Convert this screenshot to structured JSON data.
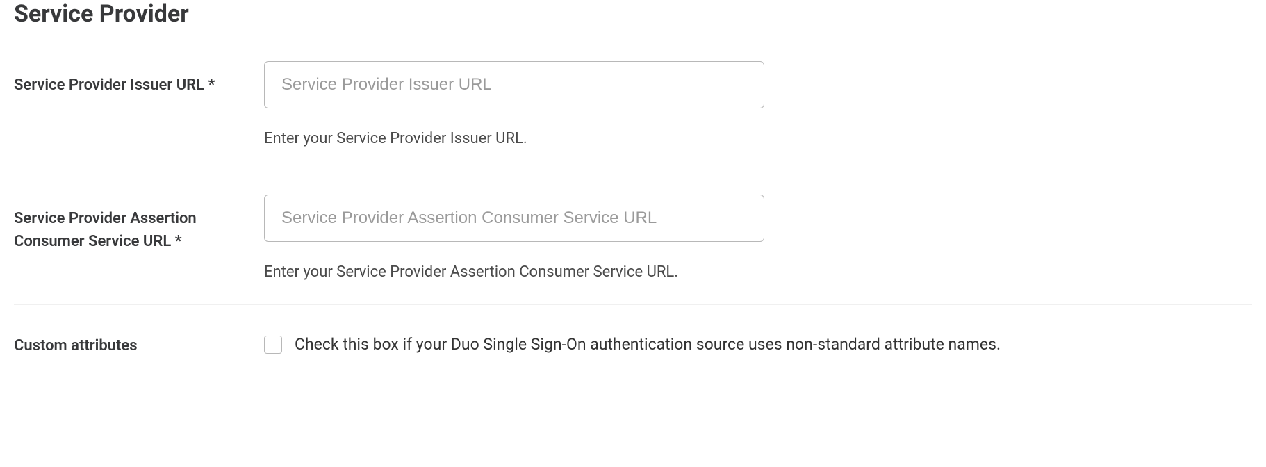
{
  "section": {
    "title": "Service Provider"
  },
  "fields": {
    "issuer_url": {
      "label": "Service Provider Issuer URL *",
      "placeholder": "Service Provider Issuer URL",
      "value": "",
      "help": "Enter your Service Provider Issuer URL."
    },
    "acs_url": {
      "label": "Service Provider Assertion Consumer Service URL *",
      "placeholder": "Service Provider Assertion Consumer Service URL",
      "value": "",
      "help": "Enter your Service Provider Assertion Consumer Service URL."
    },
    "custom_attributes": {
      "label": "Custom attributes",
      "checkbox_label": "Check this box if your Duo Single Sign-On authentication source uses non-standard attribute names.",
      "checked": false
    }
  }
}
